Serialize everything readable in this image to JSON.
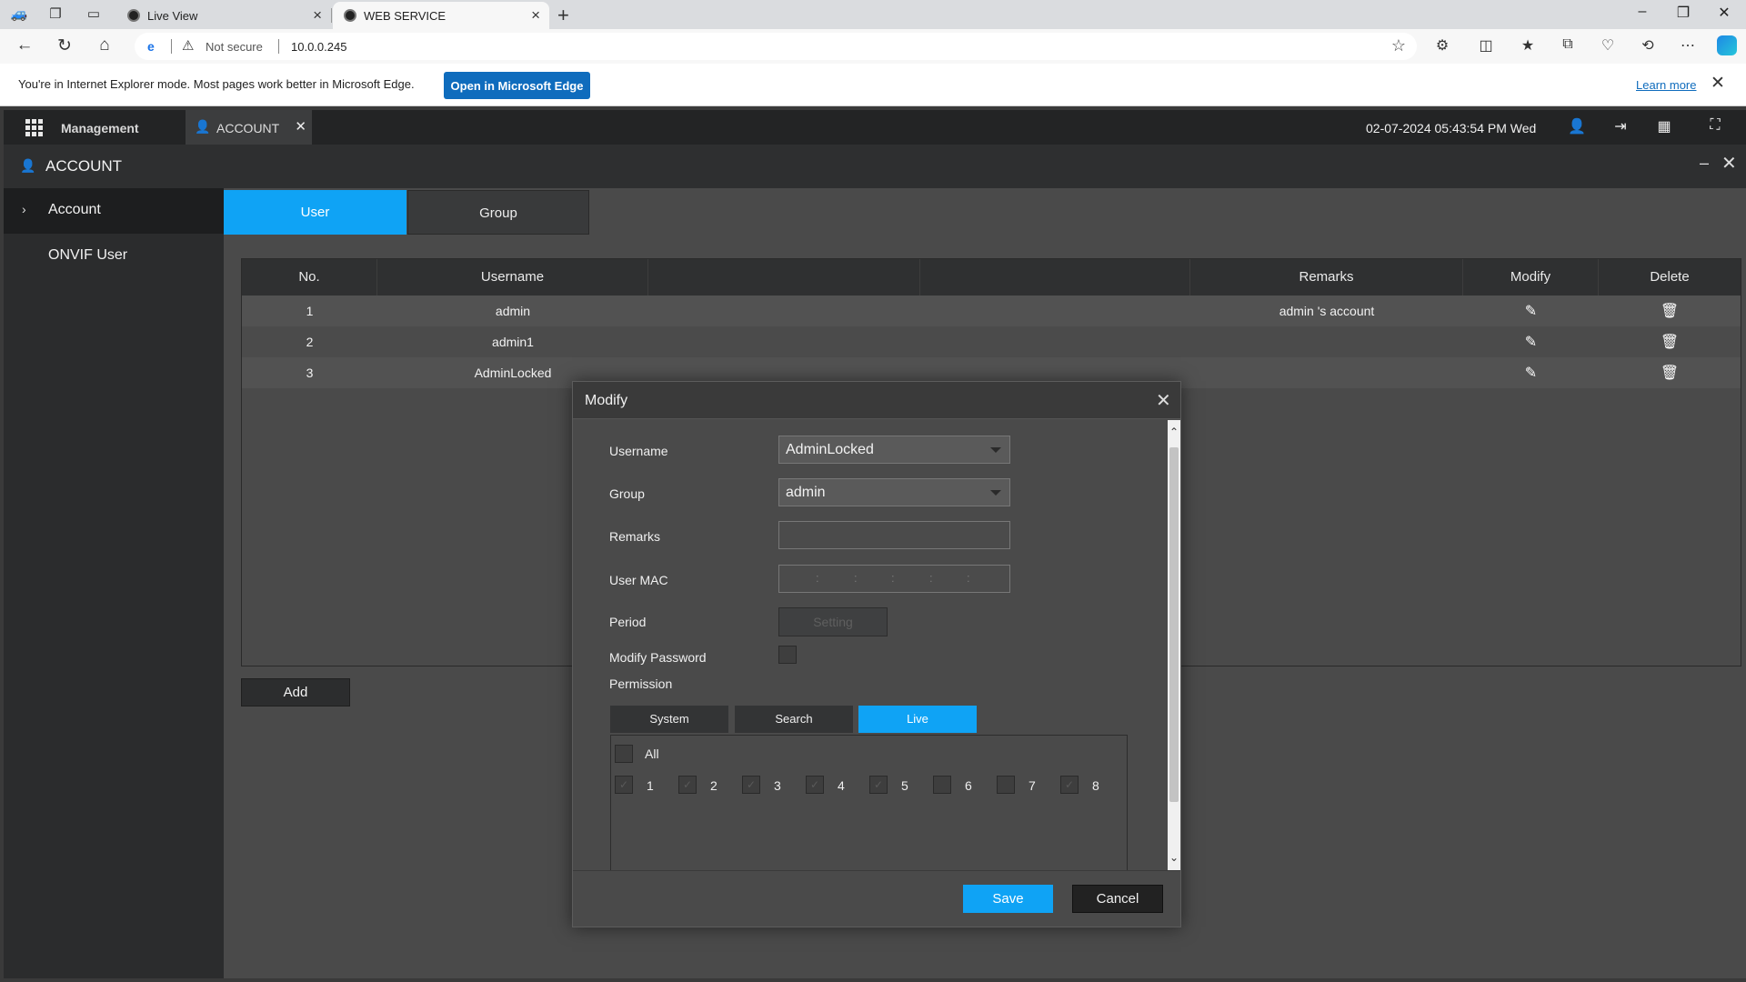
{
  "browser": {
    "tabs": [
      {
        "label": "Live View",
        "active": false
      },
      {
        "label": "WEB SERVICE",
        "active": true
      }
    ],
    "address": {
      "security": "Not secure",
      "url": "10.0.0.245"
    },
    "ie_bar": {
      "message": "You're in Internet Explorer mode. Most pages work better in Microsoft Edge.",
      "open_button": "Open in Microsoft Edge",
      "learn_more": "Learn more"
    }
  },
  "app": {
    "menu_label": "Management",
    "open_tab": "ACCOUNT",
    "datetime": "02-07-2024 05:43:54 PM Wed",
    "section_title": "ACCOUNT",
    "sidebar": [
      {
        "label": "Account",
        "active": true
      },
      {
        "label": "ONVIF User",
        "active": false
      }
    ],
    "user_tabs": [
      "User",
      "Group"
    ],
    "table": {
      "columns": [
        "No.",
        "Username",
        "",
        "",
        "Remarks",
        "Modify",
        "Delete"
      ],
      "rows": [
        {
          "no": "1",
          "username": "admin",
          "remarks": "admin 's account"
        },
        {
          "no": "2",
          "username": "admin1",
          "remarks": ""
        },
        {
          "no": "3",
          "username": "AdminLocked",
          "remarks": ""
        }
      ]
    },
    "add_button": "Add"
  },
  "modal": {
    "title": "Modify",
    "fields": {
      "username_label": "Username",
      "username_value": "AdminLocked",
      "group_label": "Group",
      "group_value": "admin",
      "remarks_label": "Remarks",
      "remarks_value": "",
      "mac_label": "User MAC",
      "period_label": "Period",
      "period_button": "Setting",
      "modify_password_label": "Modify Password",
      "permission_label": "Permission"
    },
    "permission_tabs": [
      "System",
      "Search",
      "Live"
    ],
    "active_permission_tab": "Live",
    "all_label": "All",
    "channels": [
      "1",
      "2",
      "3",
      "4",
      "5",
      "6",
      "7",
      "8"
    ],
    "channels_checked": [
      true,
      true,
      true,
      true,
      true,
      false,
      false,
      true
    ],
    "save": "Save",
    "cancel": "Cancel"
  },
  "colors": {
    "accent": "#0fa3f5",
    "edge_button": "#0f6cbd",
    "topbar": "#232425"
  }
}
